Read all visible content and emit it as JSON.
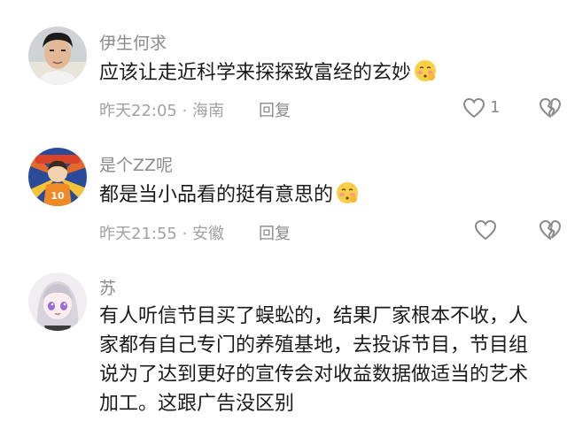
{
  "comments": [
    {
      "username": "伊生何求",
      "content": "应该让走近科学来探探致富经的玄妙",
      "emoji": "shy-face-emoji",
      "time_location": "昨天22:05 · 海南",
      "reply_label": "回复",
      "like_count": "1"
    },
    {
      "username": "是个ZZ呢",
      "content": "都是当小品看的挺有意思的",
      "emoji": "shy-face-emoji",
      "time_location": "昨天21:55 · 安徽",
      "reply_label": "回复",
      "like_count": ""
    },
    {
      "username": "苏",
      "content_lines": [
        "有人听信节目买了蜈蚣的，结果厂家根本不收，人",
        "家都有自己专门的养殖基地，去投诉节目，节目组",
        "说为了达到更好的宣传会对收益数据做适当的艺术",
        "加工。这跟广告没区别"
      ]
    }
  ],
  "colors": {
    "username": "#8a8a8a",
    "content": "#1b1b1b",
    "meta": "#a2a2a2",
    "icon": "#8a8a8a"
  }
}
